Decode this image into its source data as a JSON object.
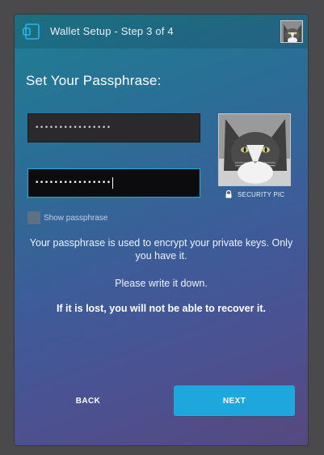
{
  "window": {
    "title": "Wallet Setup - Step 3 of 4",
    "app_icon": "wallet-icon",
    "avatar": "cat-avatar"
  },
  "main": {
    "heading": "Set Your Passphrase:",
    "passphrase_field": {
      "value": "••••••••••••••••"
    },
    "confirm_field": {
      "value": "••••••••••••••••"
    },
    "security_pic": {
      "caption": "SECURITY PIC",
      "icon": "lock-icon"
    },
    "show_passphrase": {
      "label": "Show passphrase",
      "checked": false
    },
    "info": {
      "line1": "Your passphrase is used to encrypt your private keys. Only you have it.",
      "line2": "Please write it down.",
      "line3": "If it is lost, you will not be able to recover it."
    }
  },
  "footer": {
    "back_label": "BACK",
    "next_label": "NEXT"
  },
  "colors": {
    "accent": "#1ea7dd",
    "focus_border": "#1fb0d9"
  }
}
